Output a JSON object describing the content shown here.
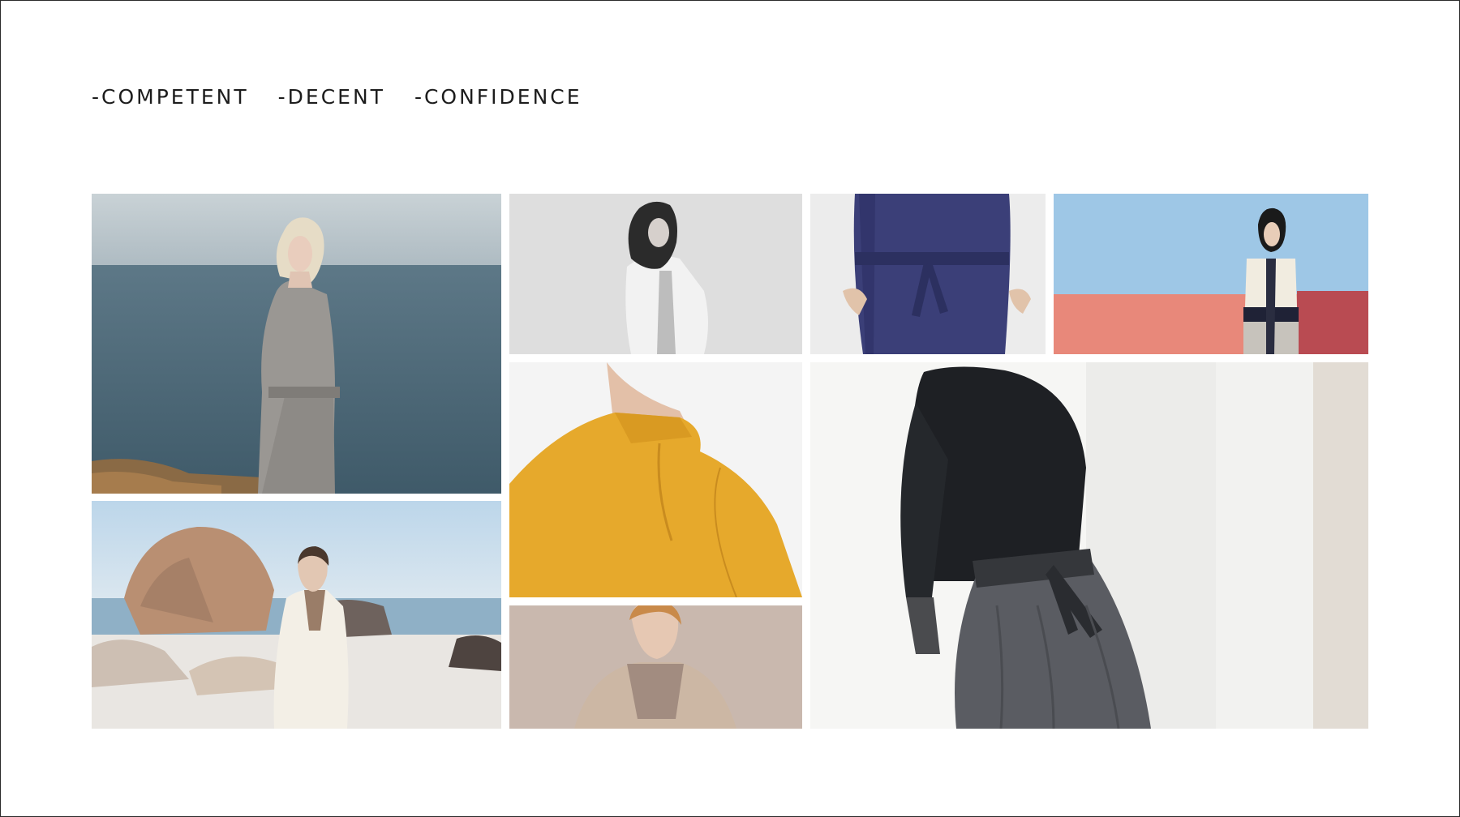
{
  "keywords": [
    "-COMPETENT",
    "-DECENT",
    "-CONFIDENCE"
  ],
  "photos": [
    {
      "name": "photo-seaside-grey-suit",
      "subject": "woman in grey shirt and trousers by the sea"
    },
    {
      "name": "photo-white-jacket-bw",
      "subject": "black-and-white portrait in white jacket"
    },
    {
      "name": "photo-navy-belted-dress",
      "subject": "navy belted dress detail"
    },
    {
      "name": "photo-colorblock-coat",
      "subject": "woman in colour-block coat against pink wall"
    },
    {
      "name": "photo-mustard-collar",
      "subject": "mustard high-neck coat detail"
    },
    {
      "name": "photo-black-knit-grey-skirt",
      "subject": "black knit top and grey skirt"
    },
    {
      "name": "photo-beach-white-coat",
      "subject": "woman in white coat on rocky beach"
    },
    {
      "name": "photo-camel-coat-portrait",
      "subject": "woman in beige coat portrait"
    }
  ]
}
